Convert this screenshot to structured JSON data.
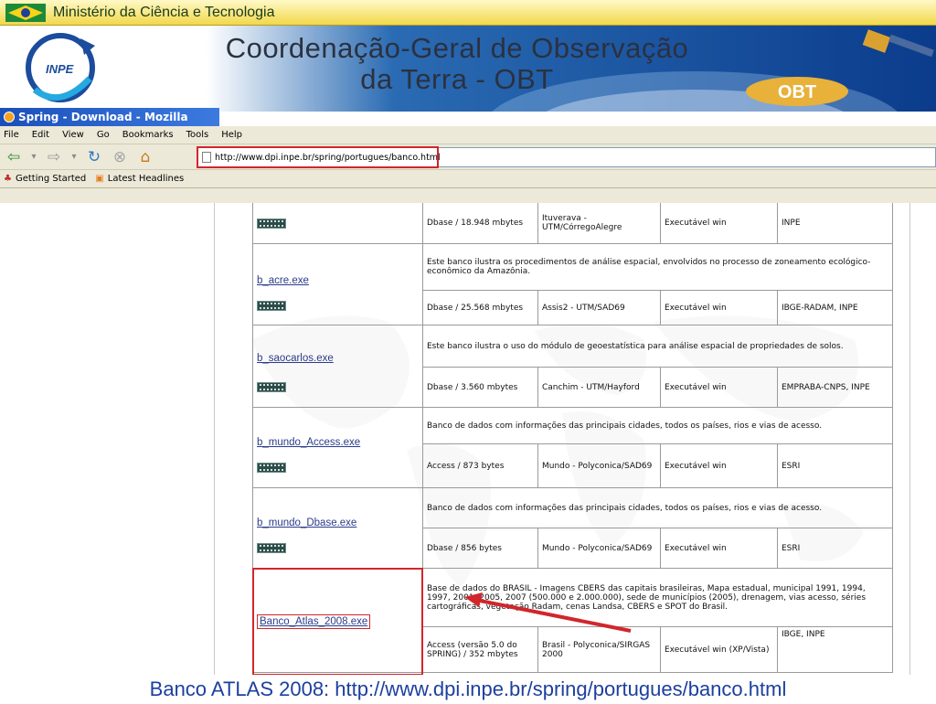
{
  "ministry": {
    "title": "Ministério da Ciência e Tecnologia"
  },
  "banner": {
    "logo_text": "INPE",
    "line1": "Coordenação-Geral de Observação",
    "line2": "da Terra - OBT",
    "obt_text": "OBT"
  },
  "browser": {
    "window_title": "Spring - Download - Mozilla Firefox",
    "menu": [
      "File",
      "Edit",
      "View",
      "Go",
      "Bookmarks",
      "Tools",
      "Help"
    ],
    "url": "http://www.dpi.inpe.br/spring/portugues/banco.html",
    "bookmarks": [
      "Getting Started",
      "Latest Headlines"
    ]
  },
  "table": {
    "rows": [
      {
        "fmt": "Dbase / 18.948 mbytes",
        "loc": "Ituverava - UTM/CórregoAlegre",
        "exe": "Executável win",
        "src": "INPE"
      },
      {
        "file": "b_acre.exe",
        "desc": "Este banco ilustra os procedimentos de análise espacial, envolvidos no processo de zoneamento ecológico-econômico da Amazônia.",
        "fmt": "Dbase / 25.568 mbytes",
        "loc": "Assis2 - UTM/SAD69",
        "exe": "Executável win",
        "src": "IBGE-RADAM, INPE"
      },
      {
        "file": "b_saocarlos.exe",
        "desc": "Este banco ilustra o uso do módulo de geoestatística para análise espacial de propriedades de solos.",
        "fmt": "Dbase / 3.560 mbytes",
        "loc": "Canchim - UTM/Hayford",
        "exe": "Executável win",
        "src": "EMPRABA-CNPS, INPE"
      },
      {
        "file": "b_mundo_Access.exe",
        "desc": "Banco de dados com informações das principais cidades, todos os países, rios e vias de acesso.",
        "fmt": "Access / 873 bytes",
        "loc": "Mundo - Polyconica/SAD69",
        "exe": "Executável win",
        "src": "ESRI"
      },
      {
        "file": "b_mundo_Dbase.exe",
        "desc": "Banco de dados com informações das principais cidades, todos os países, rios e vias de acesso.",
        "fmt": "Dbase / 856 bytes",
        "loc": "Mundo - Polyconica/SAD69",
        "exe": "Executável win",
        "src": "ESRI"
      },
      {
        "file": "Banco_Atlas_2008.exe",
        "desc": "Base de dados do BRASIL - Imagens CBERS das capitais brasileiras, Mapa estadual, municipal 1991, 1994, 1997, 2001, 2005, 2007 (500.000 e 2.000.000), sede de municípios (2005), drenagem, vias acesso, séries cartográficas, vegetação Radam, cenas Landsa, CBERS e SPOT do Brasil.",
        "fmt": "Access (versão 5.0 do SPRING) / 352 mbytes",
        "loc": "Brasil - Polyconica/SIRGAS 2000",
        "exe": "Executável win (XP/Vista)",
        "src": "IBGE, INPE"
      }
    ]
  },
  "caption": "Banco ATLAS 2008: http://www.dpi.inpe.br/spring/portugues/banco.html",
  "colors": {
    "highlight": "#d1262b",
    "link": "#2b3c8a",
    "caption": "#1c3fa0"
  }
}
